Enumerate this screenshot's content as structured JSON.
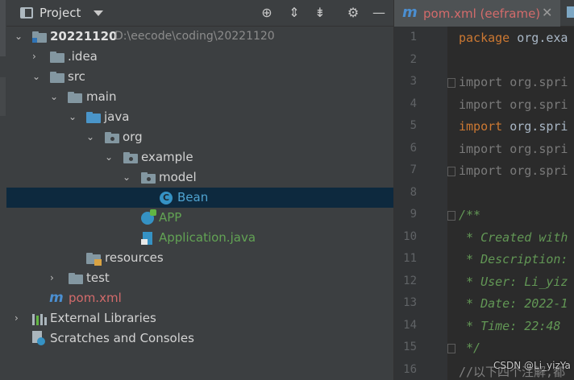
{
  "panel": {
    "title": "Project",
    "tools": [
      "crosshair-icon",
      "expand-all-icon",
      "collapse-all-icon",
      "gear-icon",
      "minimize-icon"
    ]
  },
  "tree": {
    "root_name": "20221120",
    "root_path": "D:\\eecode\\coding\\20221120",
    "idea": ".idea",
    "src": "src",
    "main": "main",
    "java": "java",
    "org": "org",
    "example": "example",
    "model": "model",
    "bean": "Bean",
    "app": "APP",
    "application": "Application.java",
    "resources": "resources",
    "test": "test",
    "pom": "pom.xml",
    "ext_libs": "External Libraries",
    "scratches": "Scratches and Consoles"
  },
  "editor": {
    "tab_title": "pom.xml (eeframe)",
    "lines": [
      {
        "n": "1",
        "parts": [
          {
            "t": "package ",
            "c": "kw"
          },
          {
            "t": "org.exa",
            "c": ""
          }
        ]
      },
      {
        "n": "2",
        "parts": []
      },
      {
        "n": "3",
        "parts": [
          {
            "t": "import ",
            "c": "dim"
          },
          {
            "t": "org.spri",
            "c": "dim"
          }
        ]
      },
      {
        "n": "4",
        "parts": [
          {
            "t": "import ",
            "c": "dim"
          },
          {
            "t": "org.spri",
            "c": "dim"
          }
        ]
      },
      {
        "n": "5",
        "parts": [
          {
            "t": "import ",
            "c": "kw"
          },
          {
            "t": "org.spri",
            "c": ""
          }
        ]
      },
      {
        "n": "6",
        "parts": [
          {
            "t": "import ",
            "c": "dim"
          },
          {
            "t": "org.spri",
            "c": "dim"
          }
        ]
      },
      {
        "n": "7",
        "parts": [
          {
            "t": "import ",
            "c": "dim"
          },
          {
            "t": "org.spri",
            "c": "dim"
          }
        ]
      },
      {
        "n": "8",
        "parts": []
      },
      {
        "n": "9",
        "parts": [
          {
            "t": "/**",
            "c": "cmt"
          }
        ]
      },
      {
        "n": "10",
        "parts": [
          {
            "t": " * Created with",
            "c": "cmt"
          }
        ]
      },
      {
        "n": "11",
        "parts": [
          {
            "t": " * Description:",
            "c": "cmt"
          }
        ]
      },
      {
        "n": "12",
        "parts": [
          {
            "t": " * User: Li_yiz",
            "c": "cmt"
          }
        ]
      },
      {
        "n": "13",
        "parts": [
          {
            "t": " * Date: 2022-1",
            "c": "cmt"
          }
        ]
      },
      {
        "n": "14",
        "parts": [
          {
            "t": " * Time: 22:48",
            "c": "cmt"
          }
        ]
      },
      {
        "n": "15",
        "parts": [
          {
            "t": " */",
            "c": "cmt"
          }
        ]
      },
      {
        "n": "16",
        "parts": [
          {
            "t": "//以下四个注解,都",
            "c": "gray-cmt"
          }
        ]
      }
    ]
  },
  "watermark": "CSDN @Li_yizYa"
}
